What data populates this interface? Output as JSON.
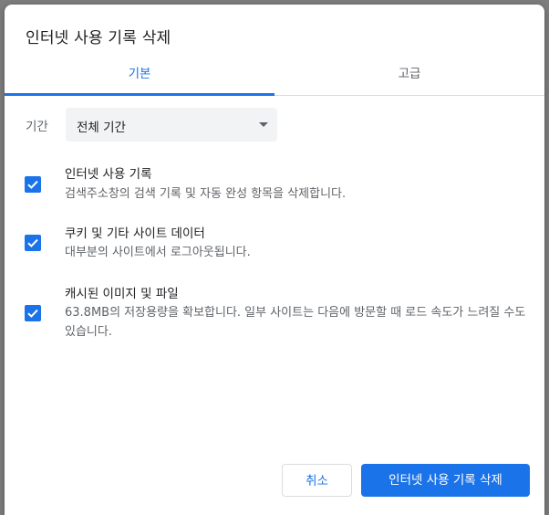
{
  "dialog": {
    "title": "인터넷 사용 기록 삭제"
  },
  "tabs": [
    {
      "label": "기본",
      "active": true
    },
    {
      "label": "고급",
      "active": false
    }
  ],
  "period": {
    "label": "기간",
    "selected": "전체 기간"
  },
  "options": [
    {
      "title": "인터넷 사용 기록",
      "description": "검색주소창의 검색 기록 및 자동 완성 항목을 삭제합니다.",
      "checked": true
    },
    {
      "title": "쿠키 및 기타 사이트 데이터",
      "description": "대부분의 사이트에서 로그아웃됩니다.",
      "checked": true
    },
    {
      "title": "캐시된 이미지 및 파일",
      "description": "63.8MB의 저장용량을 확보합니다. 일부 사이트는 다음에 방문할 때 로드 속도가 느려질 수도 있습니다.",
      "checked": true
    }
  ],
  "buttons": {
    "cancel": "취소",
    "clear": "인터넷 사용 기록 삭제"
  },
  "colors": {
    "accent": "#1a73e8",
    "text_primary": "#202124",
    "text_secondary": "#5f6368"
  }
}
